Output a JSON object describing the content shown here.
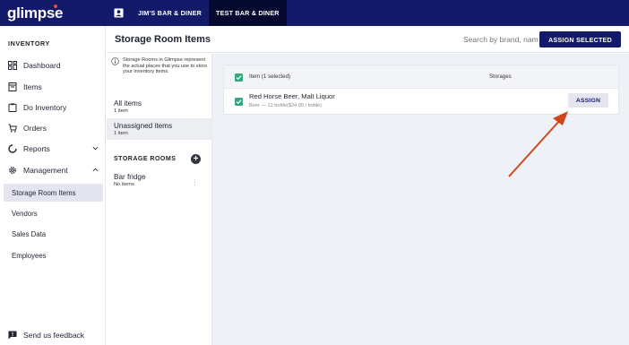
{
  "app": {
    "logo": "glimpse",
    "tabs": [
      {
        "label": "JIM'S BAR & DINER",
        "active": false
      },
      {
        "label": "TEST BAR & DINER",
        "active": true
      }
    ]
  },
  "sidebar": {
    "section_title": "INVENTORY",
    "items": [
      {
        "label": "Dashboard",
        "icon": "dashboard-icon"
      },
      {
        "label": "Items",
        "icon": "items-icon"
      },
      {
        "label": "Do Inventory",
        "icon": "clipboard-icon"
      },
      {
        "label": "Orders",
        "icon": "cart-icon"
      },
      {
        "label": "Reports",
        "icon": "reports-icon",
        "chevron": "down"
      },
      {
        "label": "Management",
        "icon": "gear-icon",
        "chevron": "up"
      }
    ],
    "sub_items": [
      {
        "label": "Storage Room Items",
        "active": true
      },
      {
        "label": "Vendors",
        "active": false
      },
      {
        "label": "Sales Data",
        "active": false
      },
      {
        "label": "Employees",
        "active": false
      }
    ],
    "feedback_label": "Send us feedback"
  },
  "header": {
    "title": "Storage Room Items",
    "search_value": "Search by brand, nam",
    "assign_selected_label": "ASSIGN SELECTED"
  },
  "rooms_panel": {
    "info_text": "Storage Rooms in Glimpse represent the actual places that you use to store your inventory items.",
    "filters": [
      {
        "name": "All items",
        "count": "1 item",
        "active": false
      },
      {
        "name": "Unassigned items",
        "count": "1 item",
        "active": true
      }
    ],
    "storage_rooms_title": "STORAGE ROOMS",
    "rooms": [
      {
        "name": "Bar fridge",
        "count": "No items"
      }
    ]
  },
  "table": {
    "header_item": "Item (1 selected)",
    "header_storages": "Storages",
    "rows": [
      {
        "name": "Red Horse Beer, Malt Liquor",
        "detail": "Beer — 12 bottle($24.00 / bottle)",
        "checked": true,
        "action_label": "ASSIGN"
      }
    ]
  },
  "colors": {
    "topbar": "#131a6a",
    "active_tab": "#05082f",
    "checkbox": "#35a77c",
    "annotation_arrow": "#d0451b"
  }
}
